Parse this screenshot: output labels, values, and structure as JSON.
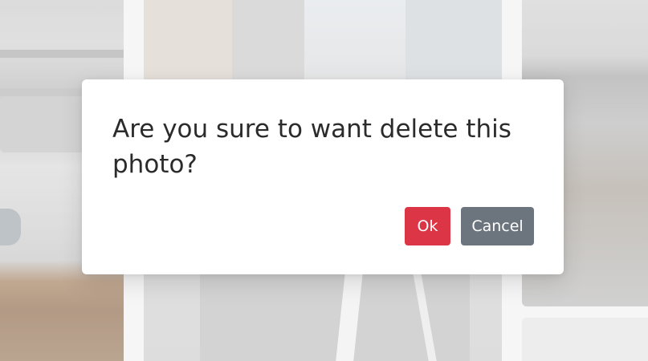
{
  "dialog": {
    "message": "Are you sure to want delete this photo?",
    "ok_label": "Ok",
    "cancel_label": "Cancel"
  },
  "colors": {
    "ok_button": "#dc3545",
    "cancel_button": "#6c757d",
    "modal_background": "#ffffff"
  }
}
